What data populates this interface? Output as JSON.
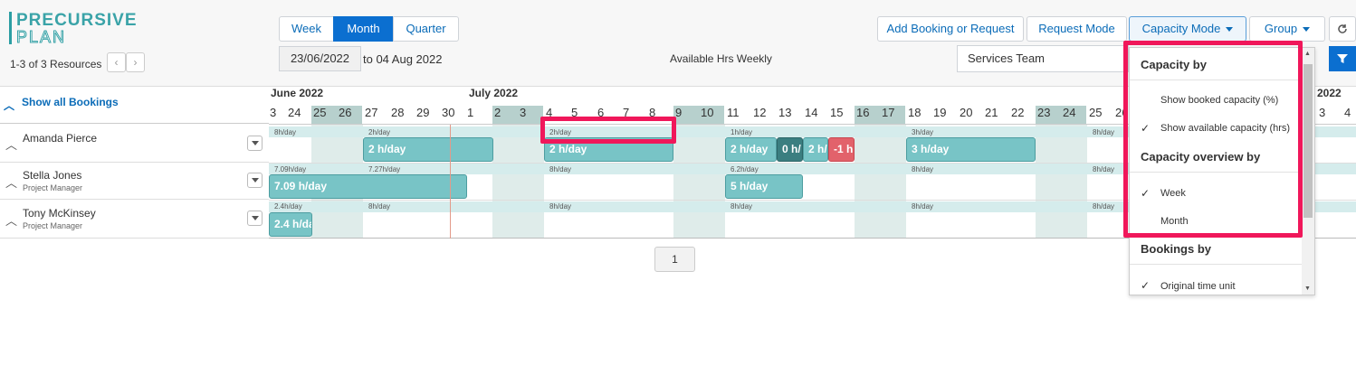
{
  "logo": {
    "line1": "PRECURSIVE",
    "line2": "PLAN"
  },
  "resources": {
    "count_text": "1-3 of 3 Resources",
    "prev": "‹",
    "next": "›"
  },
  "view_tabs": [
    {
      "label": "Week",
      "active": false
    },
    {
      "label": "Month",
      "active": true
    },
    {
      "label": "Quarter",
      "active": false
    }
  ],
  "date_range": {
    "start": "23/06/2022",
    "end_text": "to 04 Aug 2022"
  },
  "available_label": "Available Hrs Weekly",
  "toolbar": {
    "add_booking": "Add Booking or Request",
    "request_mode": "Request Mode",
    "capacity_mode": "Capacity Mode",
    "group": "Group",
    "refresh_icon": "refresh-icon",
    "filter_icon": "filter-icon"
  },
  "team_select": {
    "value": "Services Team"
  },
  "grid": {
    "show_all": "Show all Bookings",
    "months": [
      {
        "label": "June 2022"
      },
      {
        "label": "July 2022"
      },
      {
        "label": "2022"
      }
    ],
    "days": [
      "3",
      "24",
      "25",
      "26",
      "27",
      "28",
      "29",
      "30",
      "1",
      "2",
      "3",
      "4",
      "5",
      "6",
      "7",
      "8",
      "9",
      "10",
      "11",
      "12",
      "13",
      "14",
      "15",
      "16",
      "17",
      "18",
      "19",
      "20",
      "21",
      "22",
      "23",
      "24",
      "25",
      "26",
      "27",
      "28",
      "29",
      "30",
      "31",
      "1",
      "2",
      "3",
      "4"
    ]
  },
  "rows": [
    {
      "name": "Amanda Pierce",
      "role": "",
      "caps": [
        "8h/day",
        "2h/day",
        "2h/day",
        "1h/day",
        "3h/day",
        "8h/day"
      ],
      "bars": [
        "2 h/day",
        "2 h/day",
        "2 h/day",
        "0 h/",
        "2 h/",
        "-1 h",
        "3 h/day"
      ]
    },
    {
      "name": "Stella Jones",
      "role": "Project Manager",
      "caps": [
        "7.09h/day",
        "7.27h/day",
        "8h/day",
        "6.2h/day",
        "8h/day",
        "8h/day"
      ],
      "bars": [
        "7.09 h/day",
        "5 h/day"
      ]
    },
    {
      "name": "Tony McKinsey",
      "role": "Project Manager",
      "caps": [
        "2.4h/day",
        "8h/day",
        "8h/day",
        "8h/day",
        "8h/day",
        "8h/day"
      ],
      "bars": [
        "2.4 h/da"
      ]
    }
  ],
  "pagination": {
    "page": "1"
  },
  "capacity_dropdown": {
    "capacity_by": "Capacity by",
    "show_booked": "Show booked capacity (%)",
    "show_available": "Show available capacity (hrs)",
    "overview_by": "Capacity overview by",
    "week": "Week",
    "month": "Month",
    "bookings_by": "Bookings by",
    "original_unit": "Original time unit",
    "check": "✓"
  },
  "colors": {
    "accent": "#0b6fd0",
    "booking": "#78c4c6",
    "highlight": "#f0175a",
    "negative": "#e2626b"
  }
}
